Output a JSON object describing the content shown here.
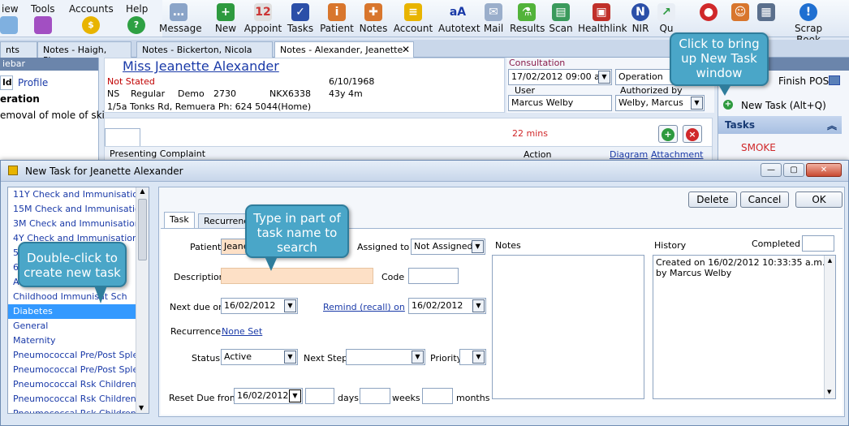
{
  "menubar": {
    "items": [
      "iew",
      "Tools",
      "Accounts",
      "Help"
    ]
  },
  "toolbar": {
    "buttons": [
      "Message",
      "New",
      "Appoint",
      "Tasks",
      "Patient",
      "Notes",
      "Account",
      "Autotext",
      "Mail",
      "Results",
      "Scan",
      "Healthlink",
      "NIR",
      "Qu",
      "Scrap Book"
    ]
  },
  "tabs": [
    "nts",
    "Notes - Haigh, Pierre",
    "Notes - Bickerton, Nicola",
    "Notes - Alexander, Jeanette"
  ],
  "left_panel": {
    "title": "iebar",
    "tabs": [
      "ld",
      "Profile"
    ],
    "heading": "eration",
    "item": "emoval of mole of ski"
  },
  "patient": {
    "name": "Miss Jeanette Alexander",
    "status": "Not Stated",
    "dob": "6/10/1968",
    "row2": [
      "NS",
      "Regular",
      "Demo",
      "2730",
      "NKX6338",
      "43y 4m"
    ],
    "address": "1/5a Tonks Rd, Remuera  Ph: 624 5044(Home)"
  },
  "consultation": {
    "label": "Consultation",
    "datetime": "17/02/2012 09:00 a.",
    "type": "Operation",
    "user_label": "User",
    "user": "Marcus Welby",
    "authorized_label": "Authorized by",
    "authorized": "Welby, Marcus"
  },
  "right_panel": {
    "finish_pos": "Finish POS",
    "new_task": "New Task (Alt+Q)",
    "tasks_header": "Tasks",
    "smoke": "SMOKE"
  },
  "note": {
    "timer": "22 mins",
    "presenting": "Presenting Complaint",
    "action": "Action",
    "diagram": "Diagram",
    "attachment": "Attachment"
  },
  "callouts": {
    "new_task": "Click to bring up New Task window",
    "type_search": "Type in part of task name to search",
    "double_click": "Double-click to create new task"
  },
  "dialog": {
    "title": "New Task  for Jeanette Alexander",
    "task_list": [
      "11Y Check and Immunisation",
      "15M Check and Immunisatio",
      "3M Check and Immunisation",
      "4Y Check and Immunisation",
      "5",
      "6",
      "A",
      "Childhood Immunisat   Sch",
      "Diabetes",
      "General",
      "Maternity",
      "Pneumococcal Pre/Post Sple",
      "Pneumococcal Pre/Post Sple",
      "Pneumococcal Rsk Children",
      "Pneumococcal Rsk Children",
      "Pneumococcal Rsk Children"
    ],
    "selected_index": 8,
    "buttons": {
      "delete": "Delete",
      "cancel": "Cancel",
      "ok": "OK"
    },
    "tabs": [
      "Task",
      "Recurrence"
    ],
    "fields": {
      "patient_label": "Patient",
      "patient_value": "Jeane",
      "assigned_label": "Assigned to",
      "assigned_value": "Not Assigned",
      "description_label": "Description",
      "description_value": "",
      "code_label": "Code",
      "next_due_label": "Next due on",
      "next_due_value": "16/02/2012",
      "remind_label": "Remind (recall) on",
      "remind_value": "16/02/2012",
      "recurrence_label": "Recurrence",
      "recurrence_value": "None Set",
      "status_label": "Status",
      "status_value": "Active",
      "next_step_label": "Next Step",
      "priority_label": "Priority",
      "reset_label": "Reset Due from",
      "reset_value": "16/02/2012",
      "days_label": "days",
      "weeks_label": "weeks",
      "months_label": "months"
    },
    "notes_label": "Notes",
    "history_label": "History",
    "completed_label": "Completed",
    "history_text": "Created on 16/02/2012 10:33:35 a.m. by Marcus Welby"
  }
}
